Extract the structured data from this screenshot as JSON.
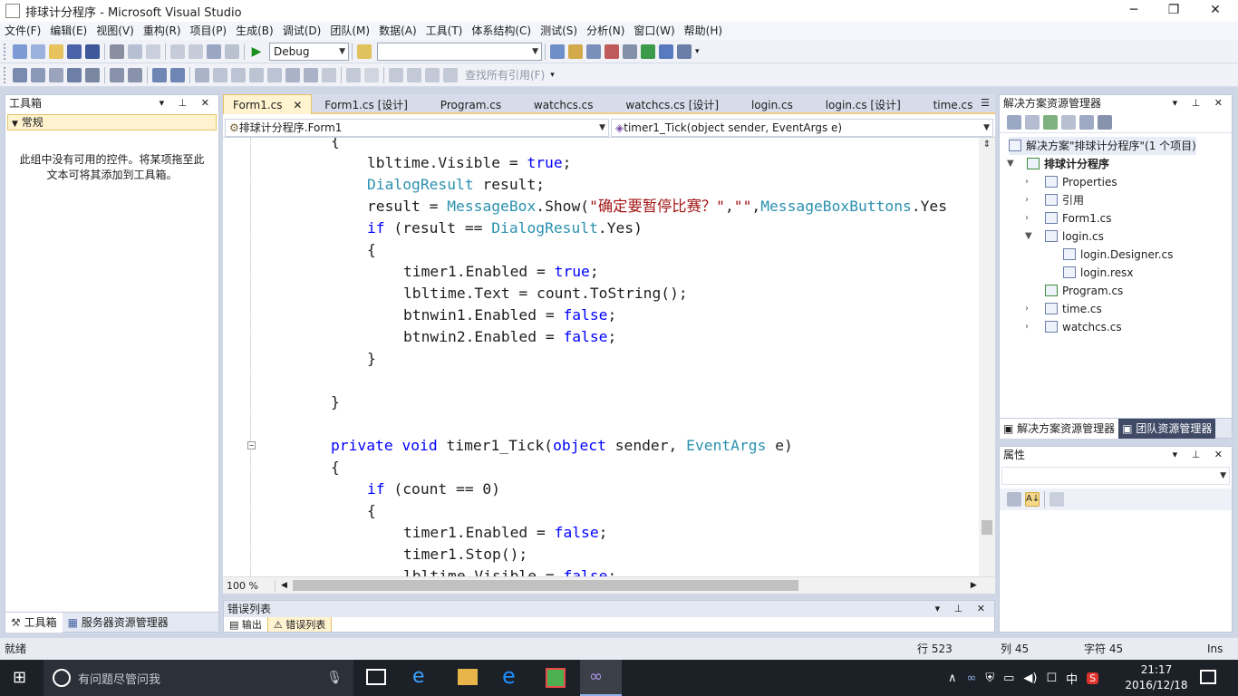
{
  "window": {
    "title": "排球计分程序 - Microsoft Visual Studio"
  },
  "menu": [
    "文件(F)",
    "编辑(E)",
    "视图(V)",
    "重构(R)",
    "项目(P)",
    "生成(B)",
    "调试(D)",
    "团队(M)",
    "数据(A)",
    "工具(T)",
    "体系结构(C)",
    "测试(S)",
    "分析(N)",
    "窗口(W)",
    "帮助(H)"
  ],
  "toolbar": {
    "config": "Debug",
    "find_placeholder": "",
    "find_all_refs": "查找所有引用(F)"
  },
  "toolbox": {
    "title": "工具箱",
    "group": "常规",
    "empty_message": "此组中没有可用的控件。将某项拖至此文本可将其添加到工具箱。",
    "tab_toolbox": "工具箱",
    "tab_server": "服务器资源管理器"
  },
  "editor": {
    "tabs": [
      "Form1.cs",
      "Form1.cs [设计]",
      "Program.cs",
      "watchcs.cs",
      "watchcs.cs [设计]",
      "login.cs",
      "login.cs [设计]",
      "time.cs"
    ],
    "active_tab": 0,
    "class_nav": "排球计分程序.Form1",
    "member_nav": "timer1_Tick(object sender, EventArgs e)",
    "zoom": "100 %",
    "lines": [
      {
        "indent": 0,
        "text": "{"
      },
      {
        "indent": 1,
        "text": "lbltime.Visible = true;"
      },
      {
        "indent": 1,
        "text": "DialogResult result;"
      },
      {
        "indent": 1,
        "text": "result = MessageBox.Show(\"确定要暂停比赛？\",\"\",MessageBoxButtons.Yes"
      },
      {
        "indent": 1,
        "text": "if (result == DialogResult.Yes)"
      },
      {
        "indent": 1,
        "text": "{"
      },
      {
        "indent": 2,
        "text": "timer1.Enabled = true;"
      },
      {
        "indent": 2,
        "text": "lbltime.Text = count.ToString();"
      },
      {
        "indent": 2,
        "text": "btnwin1.Enabled = false;"
      },
      {
        "indent": 2,
        "text": "btnwin2.Enabled = false;"
      },
      {
        "indent": 1,
        "text": "}"
      },
      {
        "indent": 0,
        "text": ""
      },
      {
        "indent": 0,
        "text": "}"
      },
      {
        "indent": 0,
        "text": ""
      },
      {
        "indent": 0,
        "text": "private void timer1_Tick(object sender, EventArgs e)"
      },
      {
        "indent": 0,
        "text": "{"
      },
      {
        "indent": 1,
        "text": "if (count == 0)"
      },
      {
        "indent": 1,
        "text": "{"
      },
      {
        "indent": 2,
        "text": "timer1.Enabled = false;"
      },
      {
        "indent": 2,
        "text": "timer1.Stop();"
      },
      {
        "indent": 2,
        "text": "lbltime.Visible = false;"
      }
    ]
  },
  "error_list": {
    "title": "错误列表",
    "tab_output": "输出",
    "tab_errors": "错误列表"
  },
  "solution_explorer": {
    "title": "解决方案资源管理器",
    "solution": "解决方案\"排球计分程序\"(1 个项目)",
    "project": "排球计分程序",
    "items": [
      "Properties",
      "引用",
      "Form1.cs",
      "login.cs",
      "login.Designer.cs",
      "login.resx",
      "Program.cs",
      "time.cs",
      "watchcs.cs"
    ],
    "tab_solution": "解决方案资源管理器",
    "tab_team": "团队资源管理器"
  },
  "properties": {
    "title": "属性"
  },
  "status": {
    "ready": "就绪",
    "line": "行 523",
    "col": "列 45",
    "char": "字符 45",
    "mode": "Ins"
  },
  "taskbar": {
    "search": "有问题尽管问我",
    "time": "21:17",
    "date": "2016/12/18",
    "ime": "中"
  },
  "colors": {
    "keyword": "#0000ff",
    "type": "#2b91af",
    "string": "#a31515",
    "active_tab": "#fff3d0",
    "taskbar": "#1c2027"
  }
}
